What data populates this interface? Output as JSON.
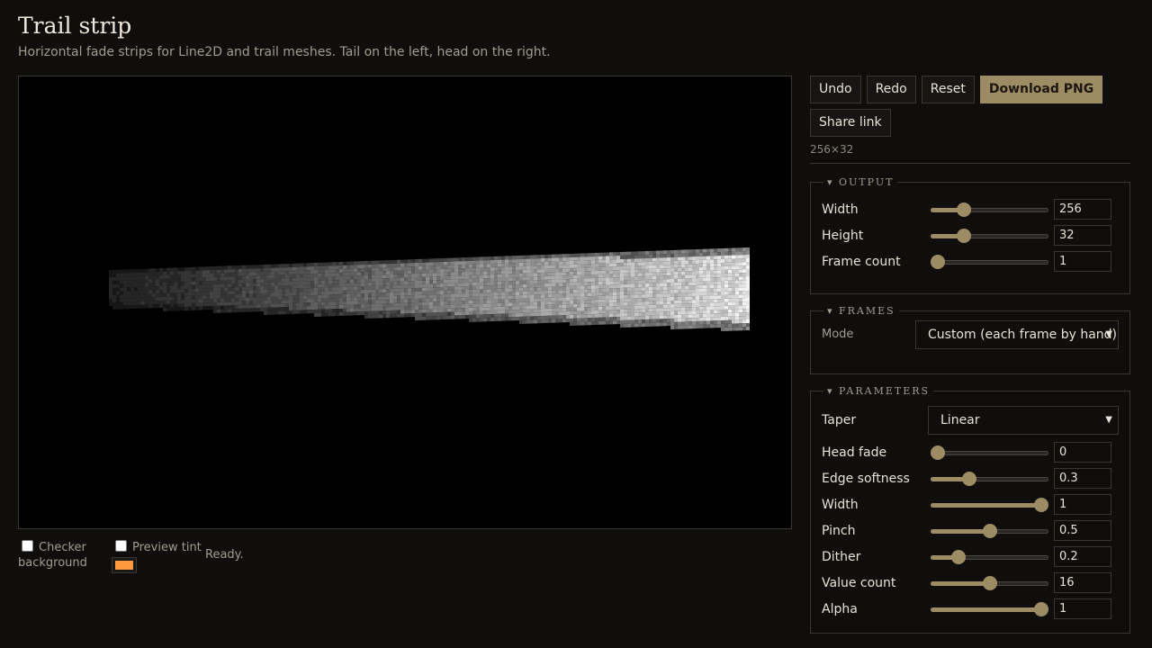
{
  "page": {
    "title": "Trail strip",
    "subtitle": "Horizontal fade strips for Line2D and trail meshes. Tail on the left, head on the right."
  },
  "toolbar": {
    "undo": "Undo",
    "redo": "Redo",
    "reset": "Reset",
    "download": "Download PNG",
    "share": "Share link",
    "dims": "256×32"
  },
  "output": {
    "legend": "▾ OUTPUT",
    "rows": [
      {
        "label": "Width",
        "value": "256",
        "fraction": 0.25
      },
      {
        "label": "Height",
        "value": "32",
        "fraction": 0.25
      },
      {
        "label": "Frame count",
        "value": "1",
        "fraction": 0.0
      }
    ]
  },
  "frames": {
    "legend": "▾ FRAMES",
    "mode_label": "Mode",
    "mode_value": "Custom (each frame by hand)"
  },
  "parameters": {
    "legend": "▾ PARAMETERS",
    "taper_label": "Taper",
    "taper_value": "Linear",
    "rows": [
      {
        "label": "Head fade",
        "value": "0",
        "fraction": 0.0
      },
      {
        "label": "Edge softness",
        "value": "0.3",
        "fraction": 0.3
      },
      {
        "label": "Width",
        "value": "1",
        "fraction": 1.0
      },
      {
        "label": "Pinch",
        "value": "0.5",
        "fraction": 0.5
      },
      {
        "label": "Dither",
        "value": "0.2",
        "fraction": 0.2
      },
      {
        "label": "Value count",
        "value": "16",
        "fraction": 0.5
      },
      {
        "label": "Alpha",
        "value": "1",
        "fraction": 1.0
      }
    ]
  },
  "preview": {
    "checker_label": "Checker background",
    "tint_label": "Preview tint",
    "tint_color": "#ff9a3c",
    "status": "Ready."
  },
  "colors": {
    "accent": "#9c8b63",
    "background": "#0f0e0d",
    "border": "#3a3733"
  }
}
